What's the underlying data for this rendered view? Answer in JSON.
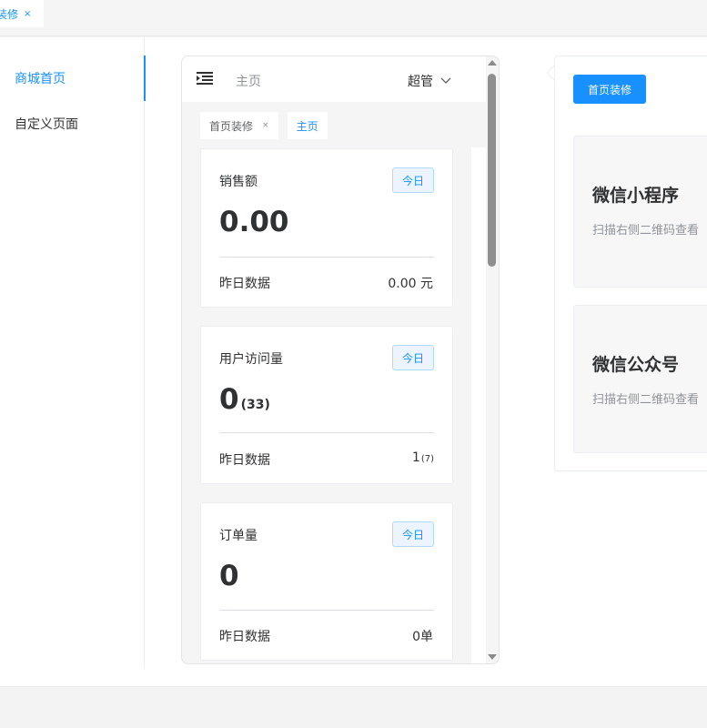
{
  "top_tab": {
    "label": "装修",
    "close": "×"
  },
  "nav": {
    "items": [
      {
        "label": "商城首页",
        "active": true
      },
      {
        "label": "自定义页面",
        "active": false
      }
    ]
  },
  "phone": {
    "header": {
      "home": "主页",
      "user": "超管"
    },
    "tabs": [
      {
        "label": "首页装修",
        "close": "×"
      },
      {
        "label": "主页"
      }
    ],
    "cards": [
      {
        "title": "销售额",
        "badge": "今日",
        "value": "0.00",
        "value_sub": "",
        "foot_label": "昨日数据",
        "foot_value": "0.00 元",
        "foot_sub": ""
      },
      {
        "title": "用户访问量",
        "badge": "今日",
        "value": "0",
        "value_sub": "(33)",
        "foot_label": "昨日数据",
        "foot_value": "1",
        "foot_sub": "(7)"
      },
      {
        "title": "订单量",
        "badge": "今日",
        "value": "0",
        "value_sub": "",
        "foot_label": "昨日数据",
        "foot_value": "0单",
        "foot_sub": ""
      }
    ]
  },
  "popover": {
    "button": "首页装修",
    "boxes": [
      {
        "title": "微信小程序",
        "desc": "扫描右侧二维码查看"
      },
      {
        "title": "微信公众号",
        "desc": "扫描右侧二维码查看"
      }
    ]
  },
  "colors": {
    "accent": "#1890ff"
  }
}
